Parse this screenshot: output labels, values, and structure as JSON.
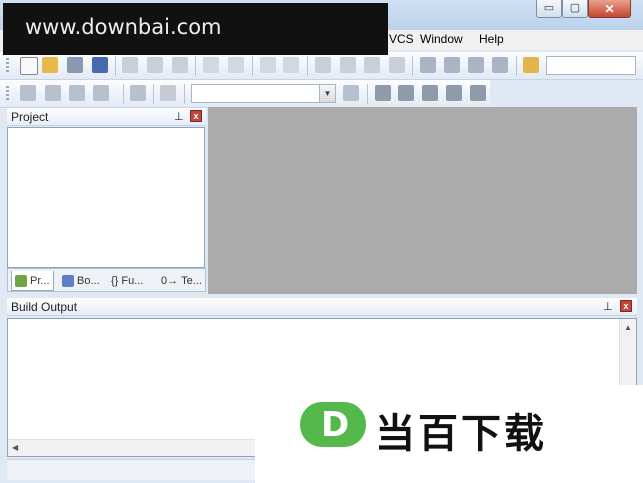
{
  "watermark": {
    "text": "www.downbai.com"
  },
  "window_controls": {
    "minimize": "▭",
    "maximize": "▢",
    "close": "✕"
  },
  "menu": {
    "items": [
      "VCS",
      "Window",
      "Help"
    ]
  },
  "toolbar1": {
    "icons": [
      "new-file-icon",
      "open-folder-icon",
      "save-icon",
      "save-all-icon",
      "cut-icon",
      "copy-icon",
      "paste-icon",
      "undo-icon",
      "redo-icon",
      "nav-back-icon",
      "nav-forward-icon",
      "bookmark-icon",
      "bookmark-prev-icon",
      "bookmark-next-icon",
      "bookmark-clear-icon",
      "indent-icon",
      "unindent-icon",
      "comment-icon",
      "uncomment-icon",
      "find-in-files-icon"
    ],
    "search_value": ""
  },
  "toolbar2": {
    "icons": [
      "translate-icon",
      "build-icon",
      "rebuild-icon",
      "batch-build-icon",
      "download-icon",
      "target-options-icon",
      "manage-components-icon",
      "select-pack-icon",
      "pack-installer-icon",
      "rte-icon"
    ],
    "target_value": ""
  },
  "project_panel": {
    "title": "Project",
    "pin": "⊥",
    "close": "x",
    "tabs": [
      {
        "label": "Pr...",
        "icon": "project-tab-icon"
      },
      {
        "label": "Bo...",
        "icon": "books-tab-icon"
      },
      {
        "label": "Fu...",
        "icon": "functions-tab-icon",
        "prefix": "{}"
      },
      {
        "label": "Te...",
        "icon": "templates-tab-icon",
        "prefix": "0→"
      }
    ]
  },
  "build_panel": {
    "title": "Build Output",
    "pin": "⊥",
    "close": "x"
  },
  "logo": {
    "badge_letter": "D",
    "text": "当百下载",
    "colors": {
      "badge": "#54b94a",
      "text": "#111111"
    }
  }
}
